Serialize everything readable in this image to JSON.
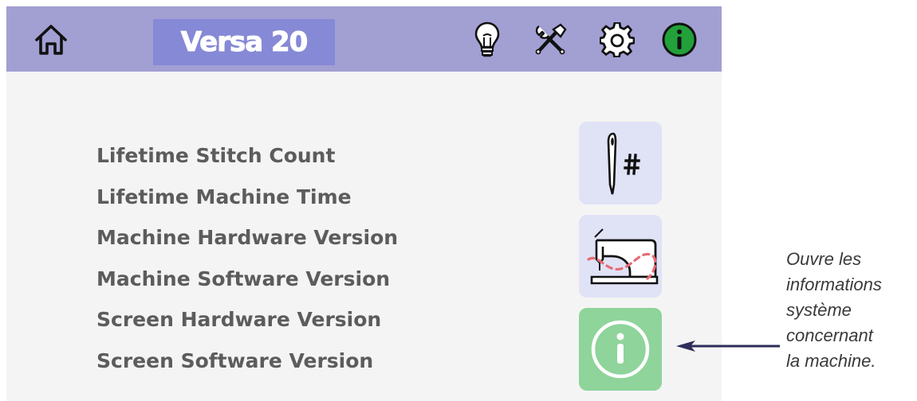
{
  "header": {
    "title": "Versa 20",
    "icons": [
      "home-icon",
      "lightbulb-icon",
      "tools-icon",
      "gear-icon",
      "info-icon"
    ]
  },
  "info_list": {
    "items": [
      "Lifetime Stitch Count",
      "Lifetime Machine Time",
      "Machine Hardware Version",
      "Machine Software Version",
      "Screen Hardware Version",
      "Screen Software Version"
    ]
  },
  "side_cards": {
    "icons": [
      "needle-hash-icon",
      "sewing-machine-icon",
      "info-icon"
    ]
  },
  "annotation": {
    "lines": [
      "Ouvre les",
      "informations",
      "système",
      "concernant",
      "la machine."
    ]
  },
  "colors": {
    "header_bg": "#a29fd3",
    "title_bg": "#8689d6",
    "info_active": "#22a03a",
    "card_bg": "#e0e2f6",
    "info_card_bg": "#8fd49a"
  }
}
